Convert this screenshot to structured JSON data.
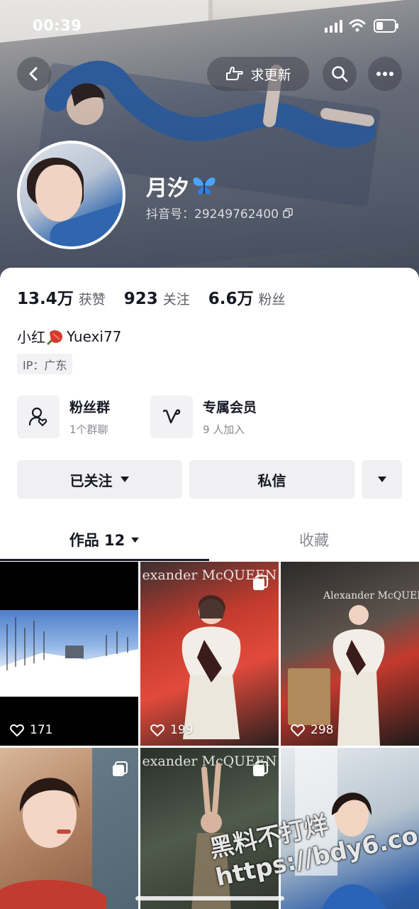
{
  "status_bar": {
    "time": "00:39"
  },
  "header": {
    "request_update_label": "求更新"
  },
  "profile": {
    "name": "月汐",
    "douyin_id": "抖音号：29249762400",
    "stats": [
      {
        "value": "13.4万",
        "label": "获赞"
      },
      {
        "value": "923",
        "label": "关注"
      },
      {
        "value": "6.6万",
        "label": "粉丝"
      }
    ],
    "bio_prefix": "小红",
    "bio_suffix": "Yuexi77",
    "ip_tag": "IP：广东"
  },
  "features": {
    "fans_group": {
      "title": "粉丝群",
      "sub": "1个群聊"
    },
    "member": {
      "title": "专属会员",
      "sub": "9 人加入"
    }
  },
  "actions": {
    "follow_label": "已关注",
    "message_label": "私信"
  },
  "tabs": {
    "works_label": "作品 12",
    "favorites_label": "收藏"
  },
  "grid": {
    "items": [
      {
        "likes": "171"
      },
      {
        "likes": "199",
        "overlay_text": "exander McQUEEN"
      },
      {
        "likes": "298",
        "overlay_text": "Alexander McQUEEN"
      },
      {
        "likes": ""
      },
      {
        "likes": "",
        "overlay_text": "exander McQUEEN"
      },
      {
        "likes": ""
      }
    ]
  },
  "watermark": {
    "line1": "黑料不打烊",
    "line2": "https://bdy6.co"
  }
}
